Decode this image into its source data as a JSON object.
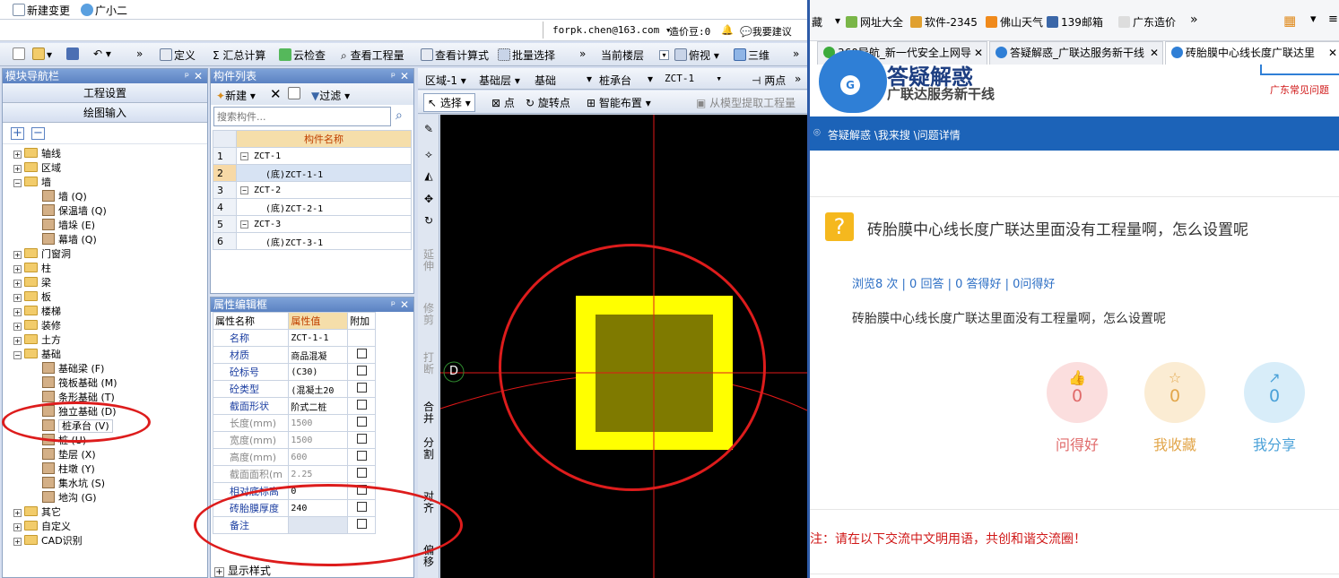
{
  "app": {
    "title_items": {
      "new_change": "新建变更",
      "assistant": "广小二"
    },
    "account": "forpk.chen@163.com ▾",
    "price": "造价豆:0",
    "suggest": "我要建议",
    "toolbar": {
      "define": "定义",
      "sum_calc": "Σ 汇总计算",
      "cloud_check": "云检查",
      "view_qty": "查看工程量",
      "view_formula": "查看计算式",
      "batch_select": "批量选择",
      "more": "»",
      "current_floor": "当前楼层",
      "top_view": "俯视",
      "three_d": "三维",
      "more2": "»"
    },
    "module_nav": {
      "title": "模块导航栏",
      "btn_project": "工程设置",
      "btn_draw": "绘图输入",
      "tree": [
        {
          "label": "轴线",
          "level": 0,
          "type": "folder",
          "sign": "+"
        },
        {
          "label": "区域",
          "level": 0,
          "type": "folder",
          "sign": "+"
        },
        {
          "label": "墙",
          "level": 0,
          "type": "folder",
          "sign": "−"
        },
        {
          "label": "墙 (Q)",
          "level": 1,
          "type": "item"
        },
        {
          "label": "保温墙 (Q)",
          "level": 1,
          "type": "item"
        },
        {
          "label": "墙垛 (E)",
          "level": 1,
          "type": "item"
        },
        {
          "label": "幕墙 (Q)",
          "level": 1,
          "type": "item"
        },
        {
          "label": "门窗洞",
          "level": 0,
          "type": "folder",
          "sign": "+"
        },
        {
          "label": "柱",
          "level": 0,
          "type": "folder",
          "sign": "+"
        },
        {
          "label": "梁",
          "level": 0,
          "type": "folder",
          "sign": "+"
        },
        {
          "label": "板",
          "level": 0,
          "type": "folder",
          "sign": "+"
        },
        {
          "label": "楼梯",
          "level": 0,
          "type": "folder",
          "sign": "+"
        },
        {
          "label": "装修",
          "level": 0,
          "type": "folder",
          "sign": "+"
        },
        {
          "label": "土方",
          "level": 0,
          "type": "folder",
          "sign": "+"
        },
        {
          "label": "基础",
          "level": 0,
          "type": "folder",
          "sign": "−"
        },
        {
          "label": "基础梁 (F)",
          "level": 1,
          "type": "item"
        },
        {
          "label": "筏板基础 (M)",
          "level": 1,
          "type": "item"
        },
        {
          "label": "条形基础 (T)",
          "level": 1,
          "type": "item"
        },
        {
          "label": "独立基础 (D)",
          "level": 1,
          "type": "item"
        },
        {
          "label": "桩承台 (V)",
          "level": 1,
          "type": "item",
          "selected": true
        },
        {
          "label": "桩 (U)",
          "level": 1,
          "type": "item"
        },
        {
          "label": "垫层 (X)",
          "level": 1,
          "type": "item"
        },
        {
          "label": "柱墩 (Y)",
          "level": 1,
          "type": "item"
        },
        {
          "label": "集水坑 (S)",
          "level": 1,
          "type": "item"
        },
        {
          "label": "地沟 (G)",
          "level": 1,
          "type": "item"
        },
        {
          "label": "其它",
          "level": 0,
          "type": "folder",
          "sign": "+"
        },
        {
          "label": "自定义",
          "level": 0,
          "type": "folder",
          "sign": "+"
        },
        {
          "label": "CAD识别",
          "level": 0,
          "type": "folder",
          "sign": "+"
        }
      ]
    },
    "component_list": {
      "title": "构件列表",
      "new_btn": "新建",
      "filter_btn": "过滤",
      "search_placeholder": "搜索构件...",
      "col_name": "构件名称",
      "rows": [
        {
          "num": "1",
          "name": "ZCT-1",
          "sign": "−"
        },
        {
          "num": "2",
          "name": "(底)ZCT-1-1",
          "child": true,
          "selected": true
        },
        {
          "num": "3",
          "name": "ZCT-2",
          "sign": "−"
        },
        {
          "num": "4",
          "name": "(底)ZCT-2-1",
          "child": true
        },
        {
          "num": "5",
          "name": "ZCT-3",
          "sign": "−"
        },
        {
          "num": "6",
          "name": "(底)ZCT-3-1",
          "child": true
        }
      ]
    },
    "prop_editor": {
      "title": "属性编辑框",
      "col_name": "属性名称",
      "col_value": "属性值",
      "col_extra": "附加",
      "rows": [
        {
          "name": "名称",
          "value": "ZCT-1-1",
          "check": false,
          "blue": true
        },
        {
          "name": "材质",
          "value": "商品混凝",
          "check": true,
          "blue": true
        },
        {
          "name": "砼标号",
          "value": "(C30)",
          "check": true,
          "blue": true
        },
        {
          "name": "砼类型",
          "value": "(混凝土20",
          "check": true,
          "blue": true
        },
        {
          "name": "截面形状",
          "value": "阶式二桩",
          "check": true,
          "blue": true
        },
        {
          "name": "长度(mm)",
          "value": "1500",
          "check": true,
          "blue": false
        },
        {
          "name": "宽度(mm)",
          "value": "1500",
          "check": true,
          "blue": false
        },
        {
          "name": "高度(mm)",
          "value": "600",
          "check": true,
          "blue": false
        },
        {
          "name": "截面面积(m",
          "value": "2.25",
          "check": true,
          "blue": false
        },
        {
          "name": "相对底标高",
          "value": "0",
          "check": true,
          "blue": true
        },
        {
          "name": "砖胎膜厚度",
          "value": "240",
          "check": true,
          "blue": true
        },
        {
          "name": "备注",
          "value": "",
          "check": true,
          "blue": true
        }
      ],
      "display_style": "显示样式"
    },
    "draw_toolbar": {
      "region": "区域-1",
      "layer": "基础层",
      "category": "基础",
      "type": "桩承台",
      "component": "ZCT-1",
      "two_points": "两点",
      "select": "选择",
      "point": "点",
      "rotate_point": "旋转点",
      "smart_layout": "智能布置",
      "extract_qty": "从模型提取工程量"
    },
    "vertical_tools": [
      "延伸",
      "修剪",
      "打断",
      "合并",
      "分割",
      "对齐",
      "偏移"
    ],
    "canvas_marker": "D"
  },
  "browser": {
    "bookmarks": [
      "藏",
      "网址大全",
      "软件-2345",
      "佛山天气",
      "139邮箱",
      "广东造价"
    ],
    "tabs": [
      "360导航_新一代安全上网导",
      "答疑解惑_广联达服务新干线",
      "砖胎膜中心线长度广联达里"
    ],
    "site_logo": "答疑解惑",
    "site_sub": "广联达服务新干线",
    "top_right_link": "广东常见问题",
    "breadcrumb": "答疑解惑 \\我来搜 \\问题详情",
    "question_title": "砖胎膜中心线长度广联达里面没有工程量啊，怎么设置呢",
    "stats": "浏览8 次 | 0 回答 | 0 答得好 | 0问得好",
    "question_body": "砖胎膜中心线长度广联达里面没有工程量啊，怎么设置呢",
    "actions": [
      {
        "count": "0",
        "label": "问得好",
        "color": "#e06a6a",
        "bg": "#fbdede"
      },
      {
        "count": "0",
        "label": "我收藏",
        "color": "#e2a64a",
        "bg": "#fbecd3"
      },
      {
        "count": "0",
        "label": "我分享",
        "color": "#4aa1d8",
        "bg": "#d8edf9"
      }
    ],
    "notice": "注：请在以下交流中文明用语，共创和谐交流圈！"
  }
}
